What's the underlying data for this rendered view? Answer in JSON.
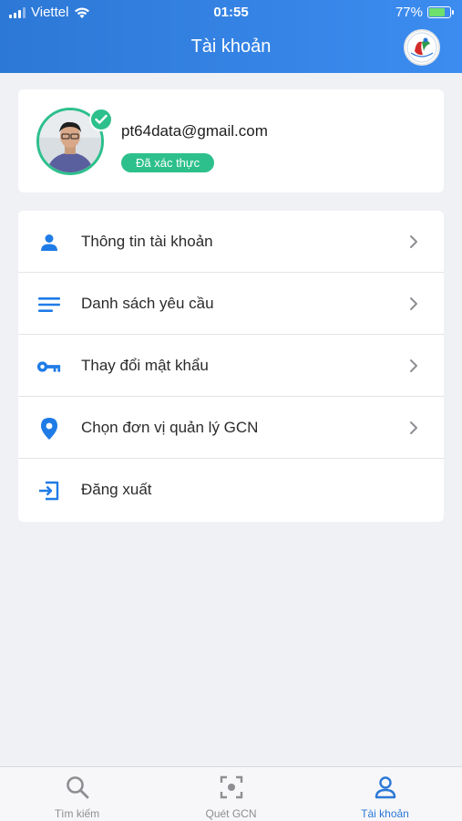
{
  "status_bar": {
    "carrier": "Viettel",
    "time": "01:55",
    "battery": "77%",
    "battery_level": 0.77
  },
  "header": {
    "title": "Tài khoản",
    "logo_icon": "agency-logo"
  },
  "profile": {
    "email": "pt64data@gmail.com",
    "verified_label": "Đã xác thực",
    "verified_color": "#2dc08c"
  },
  "menu": {
    "items": [
      {
        "label": "Thông tin tài khoản",
        "icon": "person-icon"
      },
      {
        "label": "Danh sách yêu cầu",
        "icon": "list-icon"
      },
      {
        "label": "Thay đổi mật khẩu",
        "icon": "key-icon"
      },
      {
        "label": "Chọn đơn vị quản lý GCN",
        "icon": "location-pin-icon"
      },
      {
        "label": "Đăng xuất",
        "icon": "logout-icon"
      }
    ]
  },
  "tabbar": {
    "tabs": [
      {
        "label": "Tìm kiếm",
        "icon": "search-icon",
        "active": false
      },
      {
        "label": "Quét GCN",
        "icon": "scan-icon",
        "active": false
      },
      {
        "label": "Tài khoản",
        "icon": "user-icon",
        "active": true
      }
    ]
  },
  "colors": {
    "accent": "#2c78d6",
    "icon_blue": "#1f7be6",
    "background": "#f0f1f5"
  }
}
